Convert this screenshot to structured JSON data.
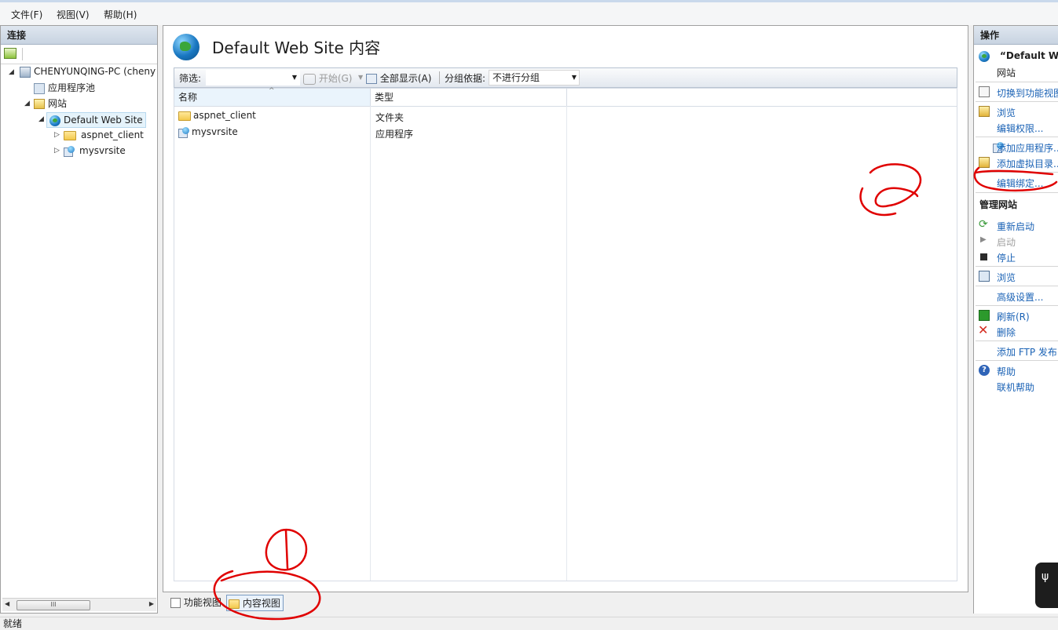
{
  "menubar": {
    "items": [
      "文件(F)",
      "视图(V)",
      "帮助(H)"
    ]
  },
  "connections": {
    "title": "连接",
    "tree": {
      "server": "CHENYUNQING-PC (cheny",
      "app_pools": "应用程序池",
      "sites": "网站",
      "default_site": "Default Web Site",
      "child1": "aspnet_client",
      "child2": "mysvrsite"
    },
    "scroll_grip": "III"
  },
  "content": {
    "title": "Default Web Site 内容",
    "filter_label": "筛选:",
    "filter_value": "",
    "start_button": "开始(G)",
    "show_all_button": "全部显示(A)",
    "group_by_label": "分组依据:",
    "group_by_value": "不进行分组",
    "columns": [
      "名称",
      "类型"
    ],
    "rows": [
      {
        "name": "aspnet_client",
        "type": "文件夹",
        "icon": "folder-icon"
      },
      {
        "name": "mysvrsite",
        "type": "应用程序",
        "icon": "application-icon"
      }
    ]
  },
  "view_switch": {
    "features_view": "功能视图",
    "content_view": "内容视图"
  },
  "actions": {
    "title": "操作",
    "site_name": "“Default We",
    "site_label": "网站",
    "items": {
      "switch_features": "切换到功能视图",
      "browse": "浏览",
      "edit_permissions": "编辑权限...",
      "add_app": "添加应用程序...",
      "add_vdir": "添加虚拟目录...",
      "edit_bindings": "编辑绑定..."
    },
    "manage_title": "管理网站",
    "manage": {
      "restart": "重新启动",
      "start": "启动",
      "stop": "停止",
      "browse": "浏览",
      "advanced": "高级设置...",
      "refresh": "刷新(R)",
      "delete": "删除",
      "add_ftp": "添加 FTP 发布...",
      "help": "帮助",
      "online_help": "联机帮助"
    }
  },
  "status": {
    "text": "就绪"
  },
  "colors": {
    "link": "#1a62b5",
    "annotation": "#e00000"
  }
}
